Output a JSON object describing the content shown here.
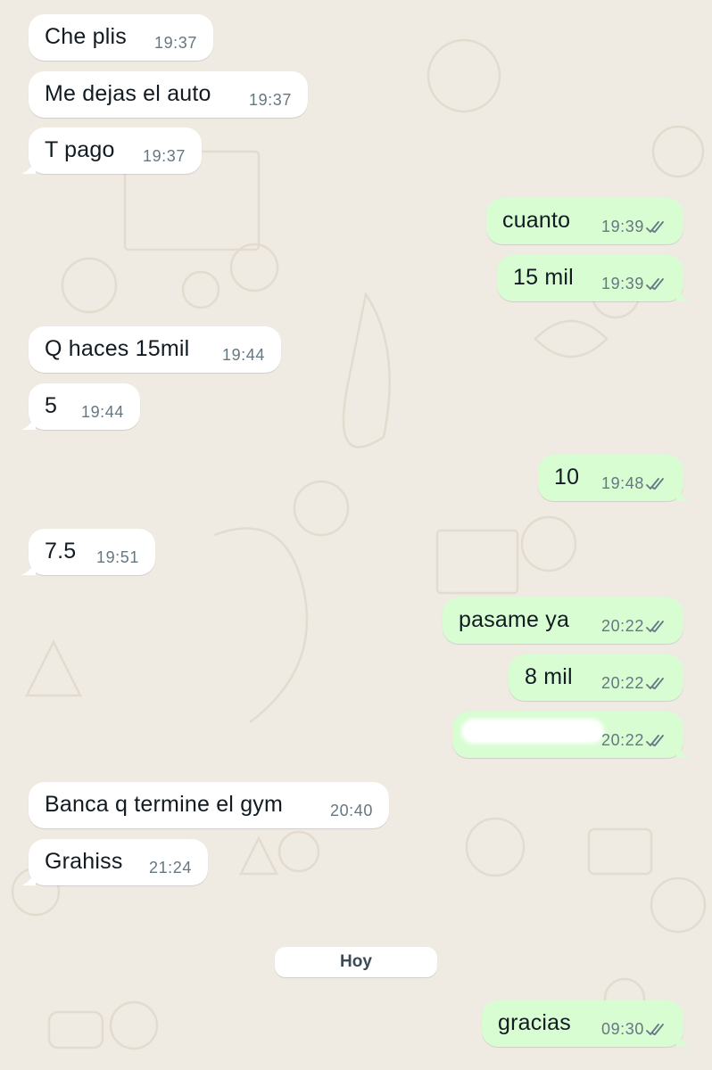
{
  "colors": {
    "background": "#efeae2",
    "incoming_bubble": "#ffffff",
    "outgoing_bubble": "#d9fdd3",
    "timestamp": "#667781",
    "read_ticks": "#667781"
  },
  "messages": [
    {
      "direction": "in",
      "text": "Che plis",
      "time": "19:37"
    },
    {
      "direction": "in",
      "text": "Me dejas el auto",
      "time": "19:37"
    },
    {
      "direction": "in",
      "text": "T pago",
      "time": "19:37"
    },
    {
      "direction": "out",
      "text": "cuanto",
      "time": "19:39",
      "status": "double-check-icon"
    },
    {
      "direction": "out",
      "text": "15 mil",
      "time": "19:39",
      "status": "double-check-icon"
    },
    {
      "direction": "in",
      "text": "Q haces 15mil",
      "time": "19:44"
    },
    {
      "direction": "in",
      "text": "5",
      "time": "19:44"
    },
    {
      "direction": "out",
      "text": "10",
      "time": "19:48",
      "status": "double-check-icon"
    },
    {
      "direction": "in",
      "text": "7.5",
      "time": "19:51"
    },
    {
      "direction": "out",
      "text": "pasame ya",
      "time": "20:22",
      "status": "double-check-icon"
    },
    {
      "direction": "out",
      "text": "8 mil",
      "time": "20:22",
      "status": "double-check-icon"
    },
    {
      "direction": "out",
      "text": "",
      "time": "20:22",
      "status": "double-check-icon",
      "redacted": true
    },
    {
      "direction": "in",
      "text": "Banca q termine el gym",
      "time": "20:40"
    },
    {
      "direction": "in",
      "text": "Grahiss",
      "time": "21:24"
    },
    {
      "direction": "out",
      "text": "gracias",
      "time": "09:30",
      "status": "double-check-icon"
    }
  ],
  "day_separator": {
    "label": "Hoy"
  }
}
